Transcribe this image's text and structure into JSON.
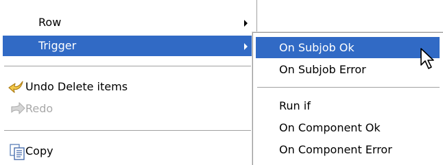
{
  "main_menu": {
    "items": [
      {
        "label": "Row",
        "state": "normal",
        "has_submenu": true
      },
      {
        "label": "Trigger",
        "state": "selected",
        "has_submenu": true
      },
      {
        "label": "Undo Delete items",
        "state": "normal",
        "icon": "undo-arrow-icon"
      },
      {
        "label": "Redo",
        "state": "disabled",
        "icon": "redo-arrow-icon"
      },
      {
        "label": "Copy",
        "state": "normal",
        "icon": "copy-icon"
      }
    ]
  },
  "sub_menu": {
    "items": [
      {
        "label": "On Subjob Ok",
        "state": "selected"
      },
      {
        "label": "On Subjob Error",
        "state": "normal"
      },
      {
        "label": "Run if",
        "state": "normal"
      },
      {
        "label": "On Component Ok",
        "state": "normal"
      },
      {
        "label": "On Component Error",
        "state": "normal"
      }
    ]
  },
  "colors": {
    "selection": "#316ac5",
    "selection_text": "#ffffff",
    "disabled_text": "#a9a9a9",
    "separator": "#a0a0a0",
    "undo_icon": "#e8b838"
  },
  "cursor": "mouse-pointer-icon"
}
